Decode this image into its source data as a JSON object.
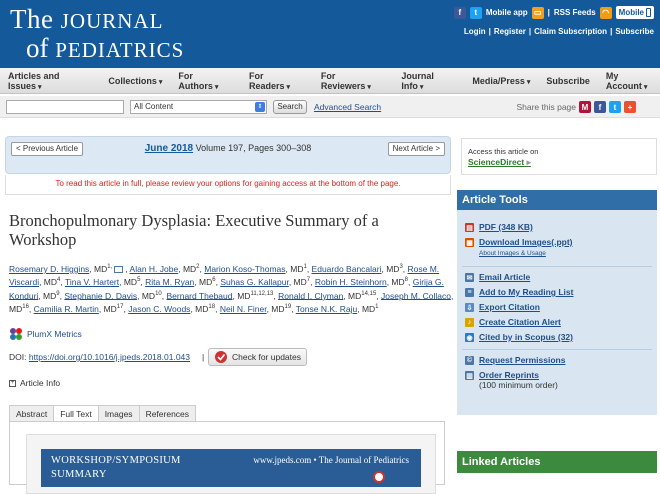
{
  "header": {
    "logo_the": "The",
    "logo_journal": "JOURNAL",
    "logo_of": "of",
    "logo_pediatrics": "PEDIATRICS",
    "mobile_app": "Mobile app",
    "rss": "RSS Feeds",
    "mobile": "Mobile",
    "account_links": [
      "Login",
      "Register",
      "Claim Subscription",
      "Subscribe"
    ],
    "sep": "|"
  },
  "nav": {
    "items": [
      "Articles and Issues",
      "Collections",
      "For Authors",
      "For Readers",
      "For Reviewers",
      "Journal Info",
      "Media/Press",
      "Subscribe",
      "My Account"
    ],
    "chevron": "▾"
  },
  "search": {
    "input_value": "",
    "select_value": "All Content",
    "button": "Search",
    "advanced": "Advanced Search",
    "share_label": "Share this page"
  },
  "article_nav": {
    "prev": "< Previous Article",
    "next": "Next Article >",
    "issue_date": "June 2018",
    "issue_detail": " Volume 197, Pages 300–308"
  },
  "access_message": "To read this article in full, please review your options for gaining access at the bottom of the page.",
  "article": {
    "title": "Bronchopulmonary Dysplasia: Executive Summary of a Workshop",
    "authors": [
      {
        "name": "Rosemary D. Higgins",
        "suffix": ", MD",
        "sup": "1,"
      },
      {
        "name": "Alan H. Jobe",
        "suffix": ", MD",
        "sup": "2"
      },
      {
        "name": "Marion Koso-Thomas",
        "suffix": ", MD",
        "sup": "1"
      },
      {
        "name": "Eduardo Bancalari",
        "suffix": ", MD",
        "sup": "3"
      },
      {
        "name": "Rose M. Viscardi",
        "suffix": ", MD",
        "sup": "4"
      },
      {
        "name": "Tina V. Hartert",
        "suffix": ", MD",
        "sup": "5"
      },
      {
        "name": "Rita M. Ryan",
        "suffix": ", MD",
        "sup": "6"
      },
      {
        "name": "Suhas G. Kallapur",
        "suffix": ", MD",
        "sup": "7"
      },
      {
        "name": "Robin H. Steinhorn",
        "suffix": ", MD",
        "sup": "8"
      },
      {
        "name": "Girija G. Konduri",
        "suffix": ", MD",
        "sup": "9"
      },
      {
        "name": "Stephanie D. Davis",
        "suffix": ", MD",
        "sup": "10"
      },
      {
        "name": "Bernard Thebaud",
        "suffix": ", MD",
        "sup": "11,12,13"
      },
      {
        "name": "Ronald I. Clyman",
        "suffix": ", MD",
        "sup": "14,15"
      },
      {
        "name": "Joseph M. Collaco",
        "suffix": ", MD",
        "sup": "16"
      },
      {
        "name": "Camilia R. Martin",
        "suffix": ", MD",
        "sup": "17"
      },
      {
        "name": "Jason C. Woods",
        "suffix": ", MD",
        "sup": "18"
      },
      {
        "name": "Neil N. Finer",
        "suffix": ", MD",
        "sup": "19"
      },
      {
        "name": "Tonse N.K. Raju",
        "suffix": ", MD",
        "sup": "1"
      }
    ],
    "plumx": "PlumX Metrics",
    "doi_label": "DOI: ",
    "doi_link": "https://doi.org/10.1016/j.jpeds.2018.01.043",
    "doi_sep": "|",
    "check_updates": "Check for updates",
    "article_info": "Article Info",
    "tabs": [
      "Abstract",
      "Full Text",
      "Images",
      "References"
    ],
    "active_tab": "Full Text"
  },
  "preview": {
    "line1": "WORKSHOP/SYMPOSIUM",
    "line2": "SUMMARY",
    "journal": "www.jpeds.com • The Journal of Pediatrics"
  },
  "sidebar": {
    "access_text": "Access this article on",
    "sciencedirect": "ScienceDirect",
    "tools_title": "Article Tools",
    "tools": {
      "pdf": "PDF (348 KB)",
      "download_images": "Download Images(.ppt)",
      "about_images": "About Images & Usage",
      "email": "Email Article",
      "reading_list": "Add to My Reading List",
      "export": "Export Citation",
      "alert": "Create Citation Alert",
      "scopus": "Cited by in Scopus (32)",
      "permissions": "Request Permissions",
      "reprints": "Order Reprints",
      "reprints_min": "(100 minimum order)"
    },
    "linked_title": "Linked Articles"
  },
  "colors": {
    "header_blue": "#14599a",
    "tools_blue": "#2f6ea6",
    "linked_green": "#3c8a3e",
    "link_blue": "#1f4e8c",
    "alert_red": "#dd2222"
  }
}
